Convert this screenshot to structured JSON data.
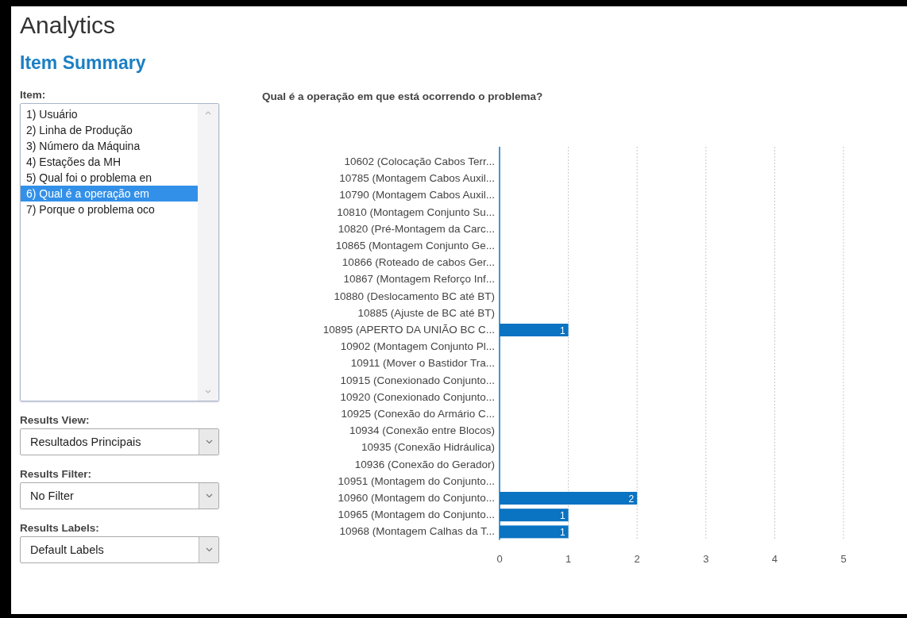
{
  "page": {
    "title": "Analytics",
    "subtitle": "Item Summary"
  },
  "item_list": {
    "label": "Item:",
    "items": [
      {
        "text": "1) Usuário",
        "selected": false
      },
      {
        "text": "2) Linha de Produção",
        "selected": false
      },
      {
        "text": "3) Número da Máquina",
        "selected": false
      },
      {
        "text": "4) Estações da MH",
        "selected": false
      },
      {
        "text": "5) Qual foi o problema en",
        "selected": false
      },
      {
        "text": "6) Qual é a operação em",
        "selected": true
      },
      {
        "text": "7) Porque o problema oco",
        "selected": false
      }
    ]
  },
  "dropdowns": [
    {
      "label": "Results View:",
      "value": "Resultados Principais"
    },
    {
      "label": "Results Filter:",
      "value": "No Filter"
    },
    {
      "label": "Results Labels:",
      "value": "Default Labels"
    }
  ],
  "chart": {
    "chart_data": {
      "type": "bar",
      "orientation": "horizontal",
      "title": "Qual é a operação em que está ocorrendo o problema?",
      "categories": [
        "10602 (Colocação Cabos Terr...",
        "10785 (Montagem Cabos Auxil...",
        "10790 (Montagem Cabos Auxil...",
        "10810 (Montagem Conjunto Su...",
        "10820 (Pré-Montagem da Carc...",
        "10865 (Montagem Conjunto Ge...",
        "10866 (Roteado de cabos Ger...",
        "10867 (Montagem Reforço Inf...",
        "10880 (Deslocamento BC até BT)",
        "10885 (Ajuste de BC até BT)",
        "10895 (APERTO DA UNIÃO BC C...",
        "10902 (Montagem Conjunto Pl...",
        "10911 (Mover o Bastidor Tra...",
        "10915 (Conexionado Conjunto...",
        "10920 (Conexionado Conjunto...",
        "10925 (Conexão do Armário C...",
        "10934 (Conexão entre Blocos)",
        "10935 (Conexão Hidráulica)",
        "10936 (Conexão do Gerador)",
        "10951 (Montagem do Conjunto...",
        "10960 (Montagem do Conjunto...",
        "10965 (Montagem do Conjunto...",
        "10968 (Montagem Calhas da T..."
      ],
      "series": [
        {
          "color": "#0a73c2",
          "values": [
            0,
            0,
            0,
            0,
            0,
            0,
            0,
            0,
            0,
            0,
            1,
            0,
            0,
            0,
            0,
            0,
            0,
            0,
            0,
            0,
            2,
            1,
            1
          ]
        }
      ],
      "xlim": [
        0,
        5
      ],
      "xticks": [
        0,
        1,
        2,
        3,
        4,
        5
      ],
      "grid": true,
      "value_labels": [
        null,
        null,
        null,
        null,
        null,
        null,
        null,
        null,
        null,
        null,
        "1",
        null,
        null,
        null,
        null,
        null,
        null,
        null,
        null,
        null,
        "2",
        "1",
        "1"
      ]
    }
  }
}
